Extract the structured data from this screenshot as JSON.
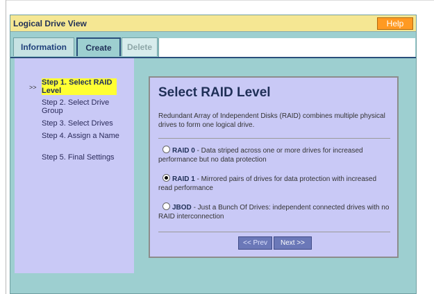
{
  "window": {
    "title": "Logical Drive View",
    "help_label": "Help"
  },
  "tabs": [
    {
      "label": "Information"
    },
    {
      "label": "Create"
    },
    {
      "label": "Delete"
    }
  ],
  "steps": {
    "marker": ">>",
    "items": [
      {
        "label": "Step 1. Select RAID Level"
      },
      {
        "label": "Step 2. Select Drive Group"
      },
      {
        "label": "Step 3. Select Drives"
      },
      {
        "label": "Step 4. Assign a Name"
      },
      {
        "label": "Step 5. Final Settings"
      }
    ]
  },
  "wizard": {
    "title": "Select RAID Level",
    "description": "Redundant Array of Independent Disks (RAID) combines multiple physical drives to form one logical drive.",
    "options": [
      {
        "name": "RAID 0",
        "text": " - Data striped across one or more drives for increased performance but no data protection",
        "selected": false
      },
      {
        "name": "RAID 1",
        "text": " - Mirrored pairs of drives for data protection with increased read performance",
        "selected": true
      },
      {
        "name": "JBOD",
        "text": " - Just a Bunch Of Drives: independent connected drives with no RAID interconnection",
        "selected": false
      }
    ],
    "prev_label": "<< Prev",
    "next_label": "Next >>"
  }
}
